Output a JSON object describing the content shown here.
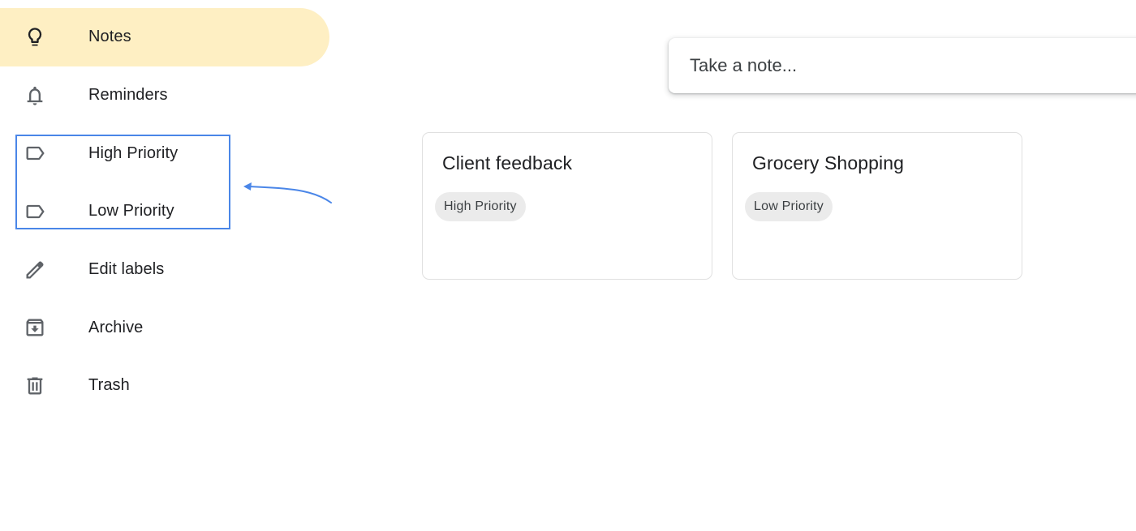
{
  "sidebar": {
    "items": [
      {
        "id": "notes",
        "label": "Notes",
        "icon": "lightbulb-icon",
        "active": true
      },
      {
        "id": "reminders",
        "label": "Reminders",
        "icon": "bell-icon",
        "active": false
      },
      {
        "id": "high-priority",
        "label": "High Priority",
        "icon": "label-icon",
        "active": false
      },
      {
        "id": "low-priority",
        "label": "Low Priority",
        "icon": "label-icon",
        "active": false
      },
      {
        "id": "edit-labels",
        "label": "Edit labels",
        "icon": "pencil-icon",
        "active": false
      },
      {
        "id": "archive",
        "label": "Archive",
        "icon": "archive-icon",
        "active": false
      },
      {
        "id": "trash",
        "label": "Trash",
        "icon": "trash-icon",
        "active": false
      }
    ],
    "active_color": "#feefc3"
  },
  "annotation": {
    "highlight_color": "#4a86e8",
    "highlighted_items": [
      "High Priority",
      "Low Priority"
    ]
  },
  "note_input": {
    "placeholder": "Take a note..."
  },
  "notes": [
    {
      "title": "Client feedback",
      "label": "High Priority"
    },
    {
      "title": "Grocery Shopping",
      "label": "Low Priority"
    }
  ]
}
